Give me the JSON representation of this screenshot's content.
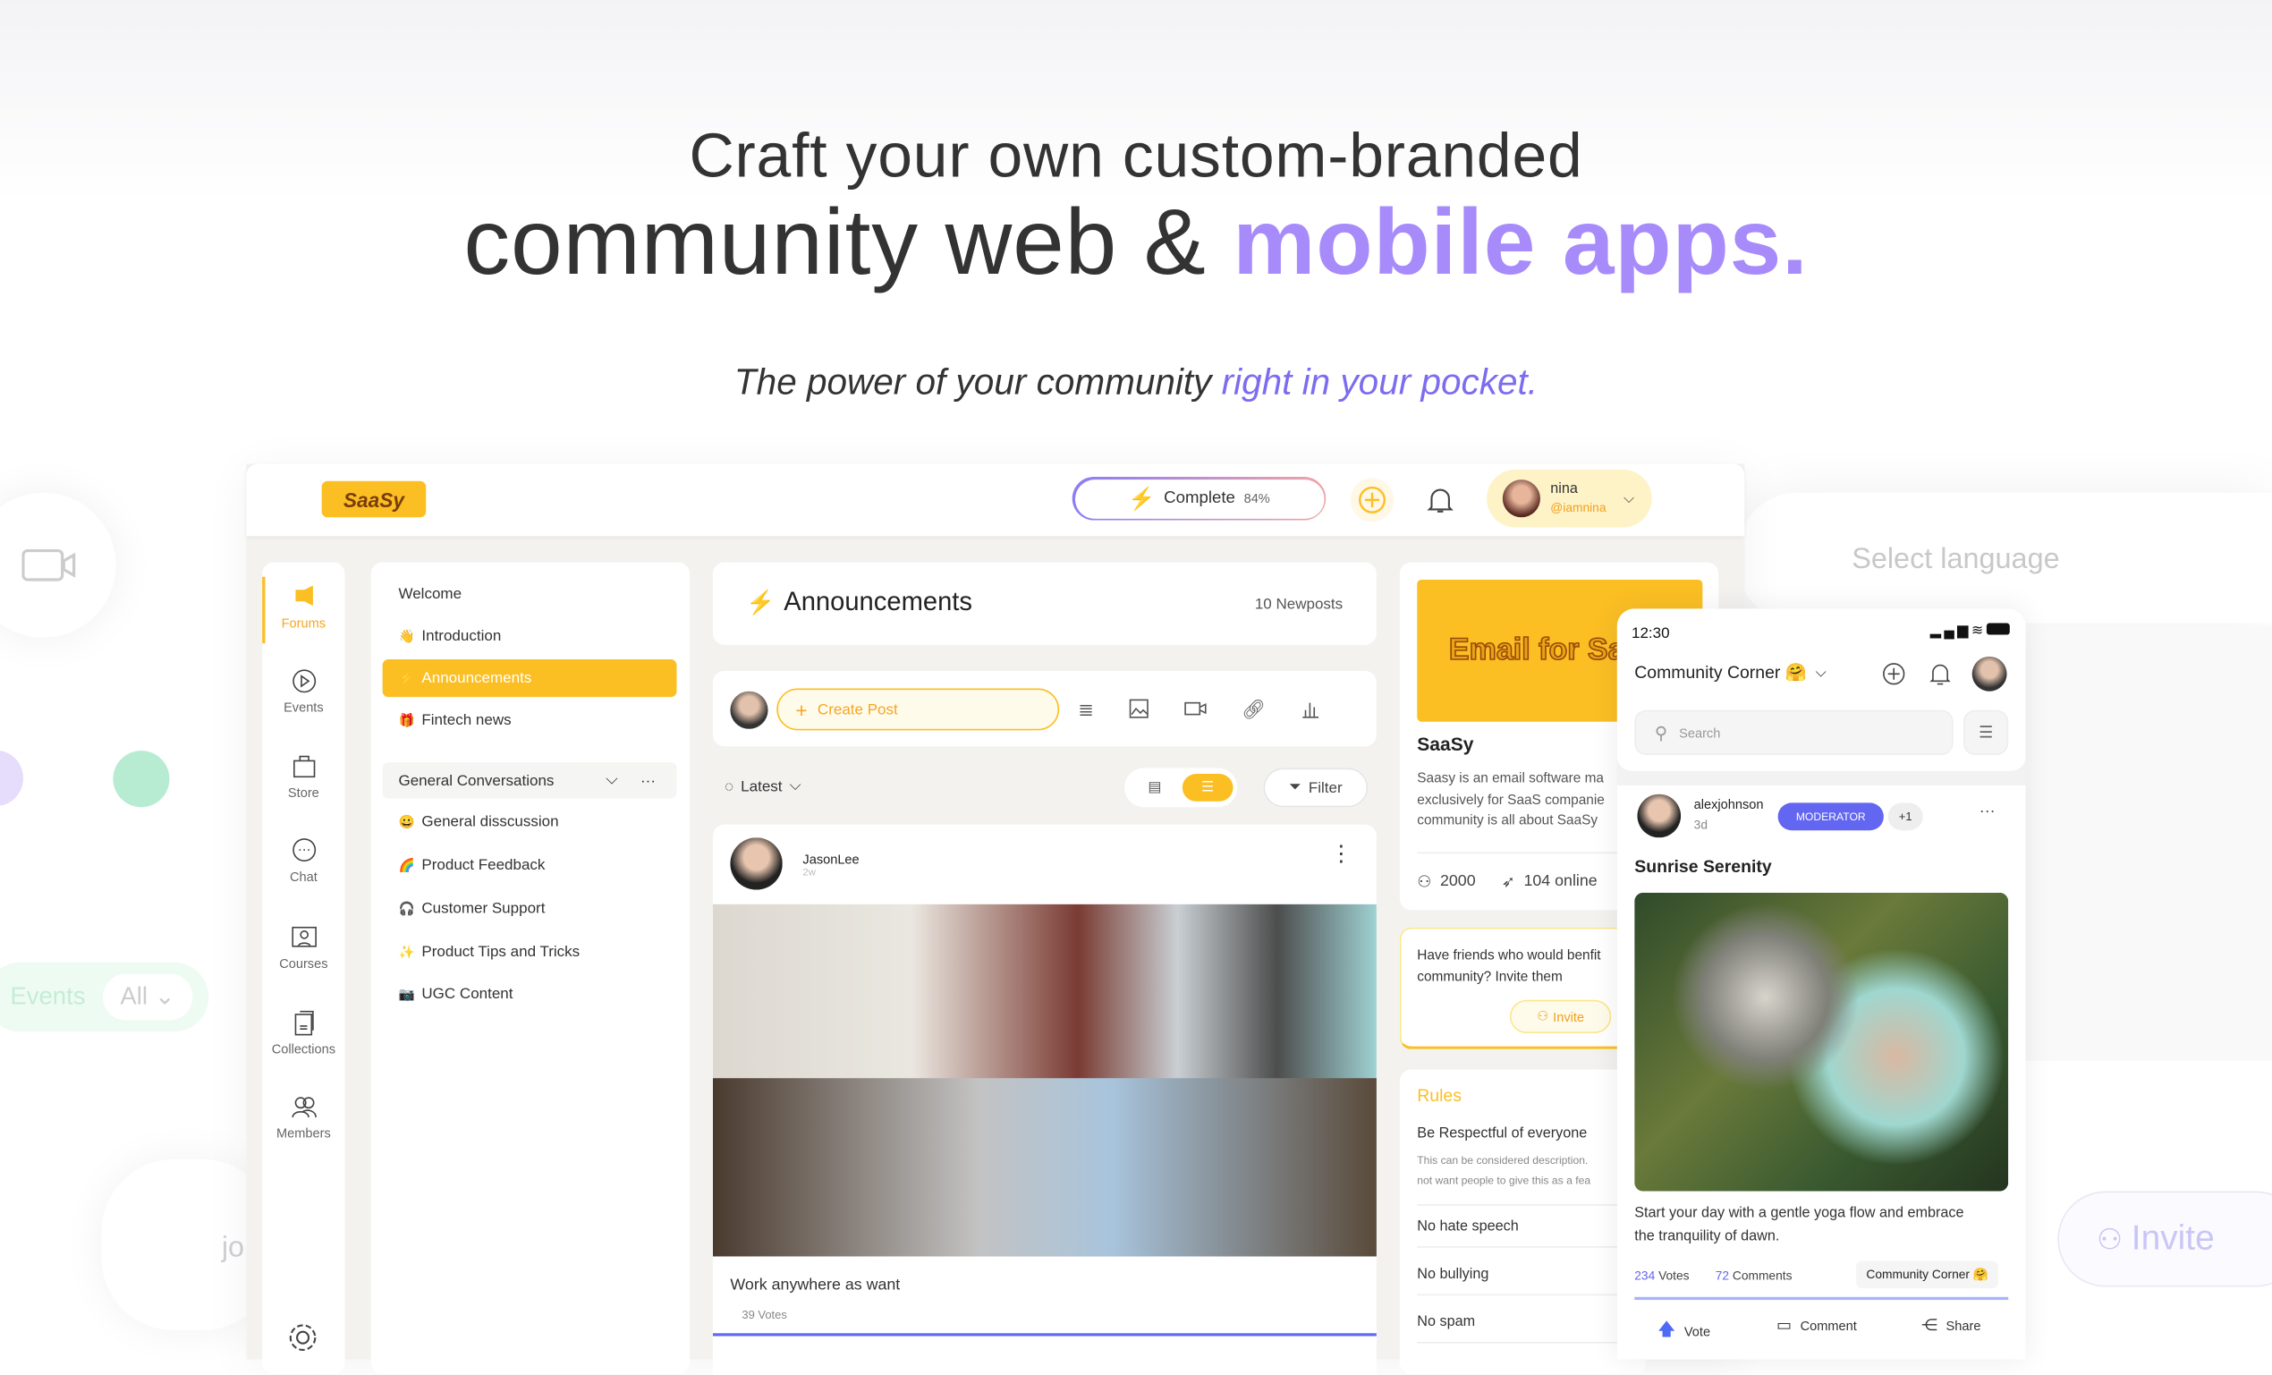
{
  "hero": {
    "line1": "Craft your own custom-branded",
    "line2_a": "community web & ",
    "line2_b": "mobile apps.",
    "sub_a": "The power of your community ",
    "sub_b": "right in your pocket."
  },
  "colors": {
    "accent_yellow": "#fbbf24",
    "accent_purple": "#a78bfa",
    "link_blue": "#6366f1",
    "moderator": "#6366f1",
    "bg": "#f3f2ef"
  },
  "background": {
    "events_label": "Events",
    "all_label": "All",
    "select_language": "Select language",
    "invite": "Invite",
    "partial_text": "jo"
  },
  "topbar": {
    "logo": "SaaSy",
    "complete_label": "Complete",
    "complete_percent": "84%",
    "complete_value": 84,
    "user_name": "nina",
    "user_handle": "@iamnina"
  },
  "nav": [
    {
      "label": "Forums",
      "icon": "megaphone-icon",
      "active": true
    },
    {
      "label": "Events",
      "icon": "play-circle-icon"
    },
    {
      "label": "Store",
      "icon": "bag-icon"
    },
    {
      "label": "Chat",
      "icon": "chat-icon"
    },
    {
      "label": "Courses",
      "icon": "courses-icon"
    },
    {
      "label": "Collections",
      "icon": "collections-icon"
    },
    {
      "label": "Members",
      "icon": "members-icon"
    }
  ],
  "channels": {
    "welcome": "Welcome",
    "top": [
      {
        "emoji": "👋",
        "label": "Introduction"
      },
      {
        "emoji": "⚡",
        "label": "Announcements",
        "active": true
      },
      {
        "emoji": "🎁",
        "label": "Fintech news"
      }
    ],
    "group": "General Conversations",
    "items": [
      {
        "emoji": "😀",
        "label": "General disscussion"
      },
      {
        "emoji": "🌈",
        "label": "Product Feedback"
      },
      {
        "emoji": "🎧",
        "label": "Customer Support"
      },
      {
        "emoji": "✨",
        "label": "Product Tips and Tricks"
      },
      {
        "emoji": "📷",
        "label": "UGC Content"
      }
    ]
  },
  "main": {
    "title": "Announcements",
    "newposts": "10 Newposts",
    "create_post": "Create Post",
    "sort": "Latest",
    "filter": "Filter",
    "post": {
      "author": "JasonLee",
      "time": "2w",
      "caption": "Work anywhere as want",
      "votes": "39 Votes"
    }
  },
  "side": {
    "banner": "Email for Sa",
    "name": "SaaSy",
    "desc": [
      "Saasy is an email software ma",
      "exclusively for SaaS companie",
      "community is all about SaaSy"
    ],
    "members": "2000",
    "online": "104 online",
    "invite_text": [
      "Have friends who would benfit",
      "community? Invite them"
    ],
    "invite_btn": "Invite",
    "rules_title": "Rules",
    "rules": [
      {
        "title": "Be Respectful of everyone",
        "desc": [
          "This can be considered description.",
          "not want people to give this as a fea"
        ]
      },
      {
        "title": "No hate speech"
      },
      {
        "title": "No bullying"
      },
      {
        "title": "No spam"
      }
    ]
  },
  "phone": {
    "time": "12:30",
    "community": "Community Corner 🤗",
    "search_placeholder": "Search",
    "author": "alexjohnson",
    "time_ago": "3d",
    "badge": "MODERATOR",
    "badge_more": "+1",
    "title": "Sunrise Serenity",
    "text": [
      "Start your day with a gentle yoga flow and embrace",
      "the tranquility of dawn."
    ],
    "votes_n": "234",
    "votes": "Votes",
    "comments_n": "72",
    "comments": "Comments",
    "tag": "Community Corner 🤗",
    "actions": [
      "Vote",
      "Comment",
      "Share"
    ]
  }
}
